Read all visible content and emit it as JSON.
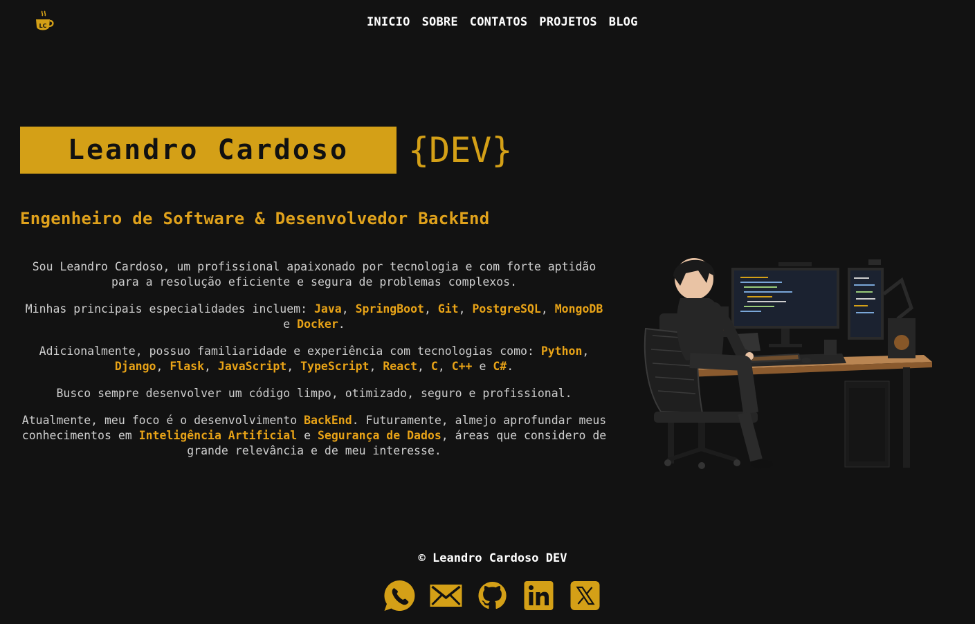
{
  "header": {
    "logo_text": "LC",
    "nav": [
      "INICIO",
      "SOBRE",
      "CONTATOS",
      "PROJETOS",
      "BLOG"
    ]
  },
  "hero": {
    "name": "Leandro Cardoso",
    "tag": "{DEV}",
    "subtitle": "Engenheiro de Software & Desenvolvedor BackEnd"
  },
  "about": {
    "p1": "Sou Leandro Cardoso, um profissional apaixonado por tecnologia e com forte aptidão para a resolução eficiente e segura de problemas complexos.",
    "p2_intro": "Minhas principais especialidades incluem: ",
    "p2_skills": [
      "Java",
      "SpringBoot",
      "Git",
      "PostgreSQL",
      "MongoDB",
      "Docker"
    ],
    "p3_intro": "Adicionalmente, possuo familiaridade e experiência com tecnologias como: ",
    "p3_skills": [
      "Python",
      "Django",
      "Flask",
      "JavaScript",
      "TypeScript",
      "React",
      "C",
      "C++",
      "C#"
    ],
    "p4": "Busco sempre desenvolver um código limpo, otimizado, seguro e profissional.",
    "p5_a": "Atualmente, meu foco é o desenvolvimento ",
    "p5_h1": "BackEnd",
    "p5_b": ". Futuramente, almejo aprofundar meus conhecimentos em ",
    "p5_h2": "Inteligência Artificial",
    "p5_c": " e ",
    "p5_h3": "Segurança de Dados",
    "p5_d": ", áreas que considero de grande relevância e de meu interesse.",
    "conj_and": "e",
    "sep": ", ",
    "end": "."
  },
  "footer": {
    "copyright": "© Leandro Cardoso DEV",
    "socials": [
      "whatsapp-icon",
      "email-icon",
      "github-icon",
      "linkedin-icon",
      "x-icon"
    ]
  },
  "colors": {
    "background": "#121212",
    "accent": "#d4a017",
    "highlight": "#e8a317"
  }
}
